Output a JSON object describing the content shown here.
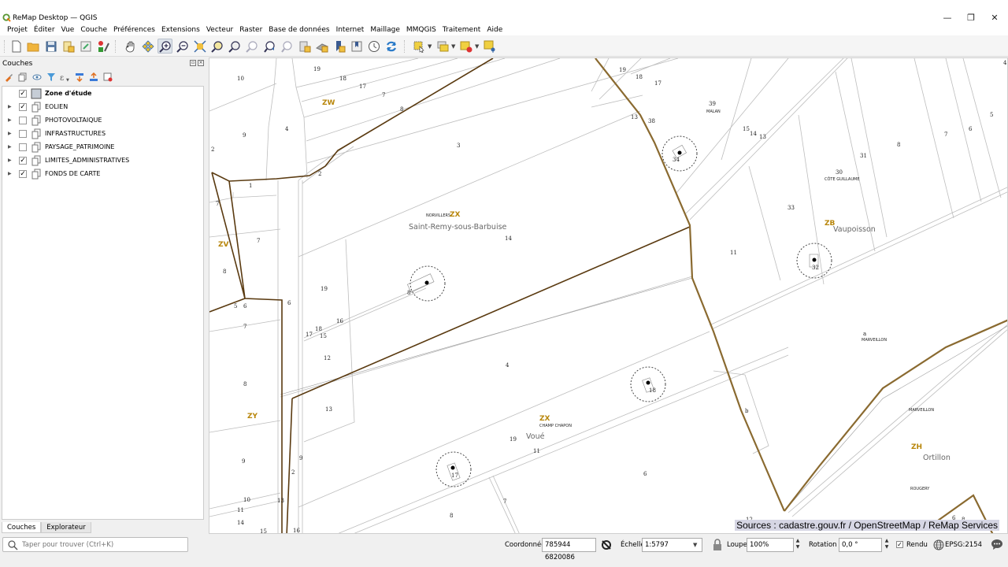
{
  "window": {
    "title": "ReMap Desktop — QGIS",
    "minimize": "—",
    "restore": "❐",
    "close": "✕"
  },
  "menu": [
    "Projet",
    "Éditer",
    "Vue",
    "Couche",
    "Préférences",
    "Extensions",
    "Vecteur",
    "Raster",
    "Base de données",
    "Internet",
    "Maillage",
    "MMQGIS",
    "Traitement",
    "Aide"
  ],
  "toolbar": {
    "icons": [
      "new-project-icon",
      "open-project-icon",
      "save-project-icon",
      "new-print-layout-icon",
      "layout-manager-icon",
      "style-manager-icon",
      "pan-icon",
      "pan-to-selection-icon",
      "zoom-in-icon",
      "zoom-out-icon",
      "zoom-full-icon",
      "zoom-to-selection-icon",
      "zoom-to-layer-icon",
      "zoom-native-icon",
      "zoom-last-icon",
      "zoom-next-icon",
      "new-map-view-icon",
      "new-3d-map-icon",
      "new-bookmark-icon",
      "show-bookmarks-icon",
      "temporal-controller-icon",
      "refresh-icon",
      "select-features-icon",
      "select-by-value-icon",
      "deselect-icon",
      "identify-icon"
    ],
    "active": "zoom-in-icon"
  },
  "layers_panel": {
    "title": "Couches",
    "tabs": [
      {
        "label": "Couches",
        "active": true
      },
      {
        "label": "Explorateur",
        "active": false
      }
    ],
    "layers": [
      {
        "name": "Zone d'étude",
        "checked": true,
        "bold": true,
        "expandable": false,
        "icon": "polygon-layer-icon"
      },
      {
        "name": "EOLIEN",
        "checked": true,
        "bold": false,
        "expandable": true,
        "icon": "layer-group-icon"
      },
      {
        "name": "PHOTOVOLTAIQUE",
        "checked": false,
        "bold": false,
        "expandable": true,
        "icon": "layer-group-icon"
      },
      {
        "name": "INFRASTRUCTURES",
        "checked": false,
        "bold": false,
        "expandable": true,
        "icon": "layer-group-icon"
      },
      {
        "name": "PAYSAGE_PATRIMOINE",
        "checked": false,
        "bold": false,
        "expandable": true,
        "icon": "layer-group-icon"
      },
      {
        "name": "LIMITES_ADMINISTRATIVES",
        "checked": true,
        "bold": false,
        "expandable": true,
        "icon": "layer-group-icon"
      },
      {
        "name": "FONDS DE CARTE",
        "checked": true,
        "bold": false,
        "expandable": true,
        "icon": "layer-group-icon"
      }
    ]
  },
  "search": {
    "placeholder": "Taper pour trouver (Ctrl+K)"
  },
  "map": {
    "attribution": "Sources : cadastre.gouv.fr / OpenStreetMap / ReMap Services",
    "sections": [
      "ZW",
      "ZV",
      "ZY",
      "ZX",
      "ZX",
      "ZB",
      "ZH"
    ],
    "communes": [
      "Saint-Remy-sous-Barbuise",
      "Vaupoisson",
      "Voué",
      "Ortillon"
    ],
    "lieux_dits": [
      "NORVILLERS",
      "MALAN",
      "CÔTE GUILLAUME",
      "CHAMP CHAPON",
      "MARVEILLON",
      "MARVEILLON",
      "ROUGERY"
    ],
    "turbines": [
      "34",
      "32",
      "8",
      "18",
      "17"
    ]
  },
  "status": {
    "coord_label": "Coordonnée",
    "coord_value": "785944 6820086",
    "scale_label": "Échelle",
    "scale_value": "1:5797",
    "magnifier_label": "Loupe",
    "magnifier_value": "100%",
    "rotation_label": "Rotation",
    "rotation_value": "0,0 °",
    "render_label": "Rendu",
    "render_checked": true,
    "crs": "EPSG:2154"
  }
}
